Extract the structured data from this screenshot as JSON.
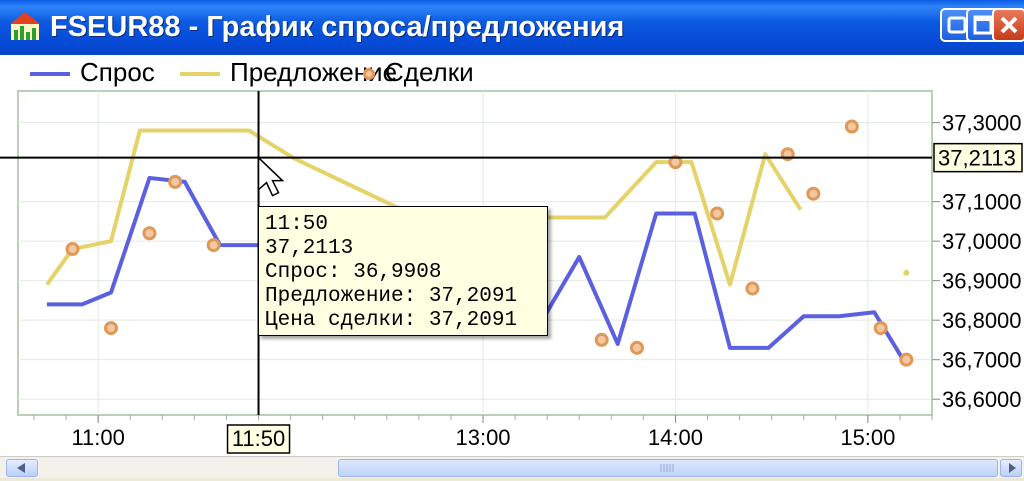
{
  "window": {
    "title": "FSEUR88 - График спроса/предложения",
    "icon": "chart-app-icon"
  },
  "title_buttons": [
    "minimize",
    "maximize",
    "close"
  ],
  "legend": [
    {
      "label": "Спрос",
      "color": "#5A60E0"
    },
    {
      "label": "Предложение",
      "color": "#E5D268"
    },
    {
      "label": "Сделки",
      "color": "#E09858"
    }
  ],
  "crosshair": {
    "x_label": "11:50",
    "y_label": "37,2113"
  },
  "tooltip": {
    "time": "11:50",
    "price": "37,2113",
    "demand": "Спрос: 36,9908",
    "supply": "Предложение: 37,2091",
    "deal": "Цена сделки: 37,2091"
  },
  "chart_data": {
    "type": "line",
    "x_ticks": [
      "11:00",
      "13:00",
      "14:00",
      "15:00"
    ],
    "y_ticks": [
      "37,3000",
      "37,1000",
      "37,0000",
      "36,9000",
      "36,8000",
      "36,7000",
      "36,6000"
    ],
    "ylim": [
      36.56,
      37.38
    ],
    "series": [
      {
        "name": "Спрос",
        "color": "#5A60E0",
        "x": [
          "10:44",
          "10:55",
          "11:04",
          "11:16",
          "11:27",
          "11:38",
          "11:50",
          "12:00",
          "13:03",
          "13:17",
          "13:30",
          "13:42",
          "13:54",
          "14:06",
          "14:17",
          "14:29",
          "14:40",
          "14:51",
          "15:02",
          "15:11"
        ],
        "y": [
          36.84,
          36.84,
          36.87,
          37.16,
          37.15,
          36.99,
          36.99,
          36.99,
          36.78,
          36.78,
          36.96,
          36.74,
          37.07,
          37.07,
          36.73,
          36.73,
          36.81,
          36.81,
          36.82,
          36.7
        ]
      },
      {
        "name": "Предложение",
        "color": "#E5D268",
        "x": [
          "10:44",
          "10:52",
          "11:04",
          "11:13",
          "11:24",
          "11:36",
          "11:47",
          "12:01",
          "13:03",
          "13:13",
          "13:25",
          "13:38",
          "13:54",
          "14:05",
          "14:17",
          "14:28",
          "14:39"
        ],
        "y": [
          36.89,
          36.98,
          37.0,
          37.28,
          37.28,
          37.28,
          37.28,
          37.21,
          36.97,
          37.06,
          37.06,
          37.06,
          37.2,
          37.2,
          36.89,
          37.22,
          37.08
        ]
      },
      {
        "name": "Сделки",
        "color": "#E09858",
        "type": "scatter",
        "x": [
          "10:52",
          "11:04",
          "11:16",
          "11:24",
          "11:36",
          "13:37",
          "13:48",
          "14:00",
          "14:13",
          "14:24",
          "14:35",
          "14:43",
          "14:55",
          "15:04",
          "15:12"
        ],
        "y": [
          36.98,
          36.78,
          37.02,
          37.15,
          36.99,
          36.75,
          36.73,
          37.2,
          37.07,
          36.88,
          37.22,
          37.12,
          37.29,
          36.78,
          36.7
        ]
      }
    ]
  }
}
